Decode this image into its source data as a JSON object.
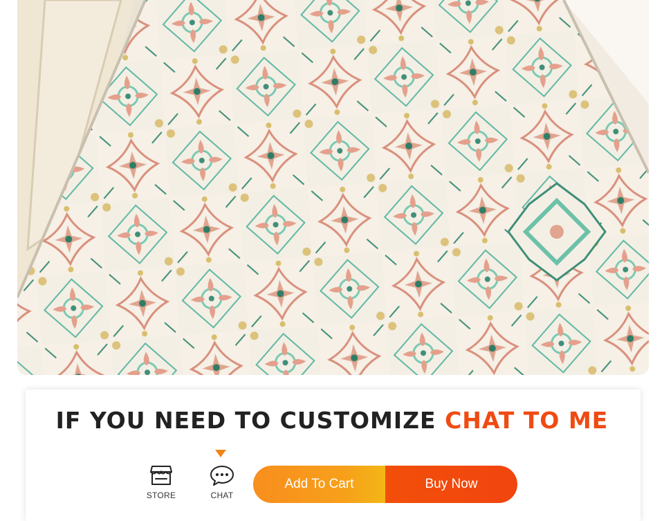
{
  "product_image": {
    "subject": "patterned hallway runner rug"
  },
  "promo": {
    "headline_main": "IF YOU NEED TO CUSTOMIZE",
    "headline_accent": "CHAT TO ME"
  },
  "actions": {
    "store_label": "STORE",
    "chat_label": "CHAT",
    "add_to_cart_label": "Add To Cart",
    "buy_now_label": "Buy Now"
  },
  "colors": {
    "accent": "#ef4b12",
    "pointer": "#f08516",
    "add_to_cart": "#f7a01a",
    "buy_now": "#f1450f",
    "headline": "#222222"
  },
  "icons": [
    "store-icon",
    "chat-icon"
  ]
}
